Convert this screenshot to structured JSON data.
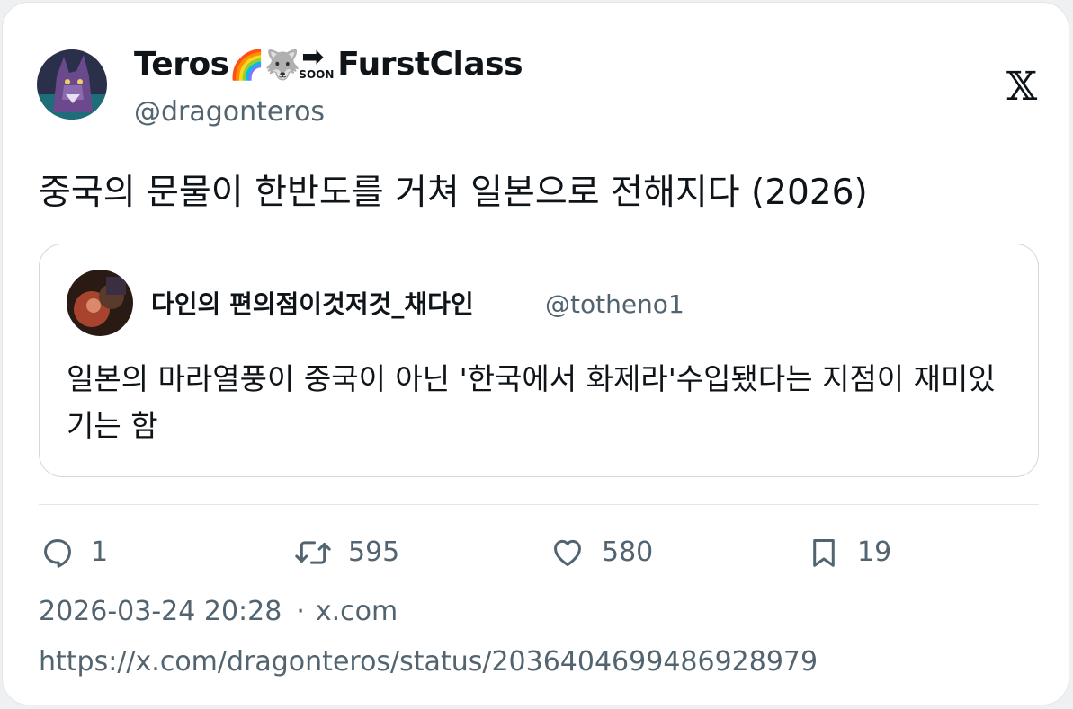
{
  "author": {
    "display_name_prefix": "Teros",
    "display_name_emojis": "🌈🐺",
    "soon_arrow": "➡",
    "soon_label": "SOON",
    "display_name_suffix": "FurstClass",
    "handle": "@dragonteros"
  },
  "brand_logo": "𝕏",
  "tweet": {
    "text": "중국의 문물이 한반도를 거쳐 일본으로 전해지다 (2026)"
  },
  "quoted": {
    "display_name": "다인의 편의점이것저것_채다인",
    "handle": "@totheno1",
    "text": "일본의 마라열풍이 중국이 아닌 '한국에서 화제라'수입됐다는 지점이 재미있기는 함"
  },
  "stats": {
    "replies": "1",
    "retweets": "595",
    "likes": "580",
    "bookmarks": "19"
  },
  "meta": {
    "timestamp": "2026-03-24 20:28",
    "separator": "·",
    "source": "x.com"
  },
  "url": "https://x.com/dragonteros/status/2036404699486928979",
  "colors": {
    "text_primary": "#0f1419",
    "text_secondary": "#536471",
    "border": "#cfd9de"
  },
  "icons": [
    "reply-icon",
    "retweet-icon",
    "like-icon",
    "bookmark-icon",
    "x-logo-icon"
  ]
}
